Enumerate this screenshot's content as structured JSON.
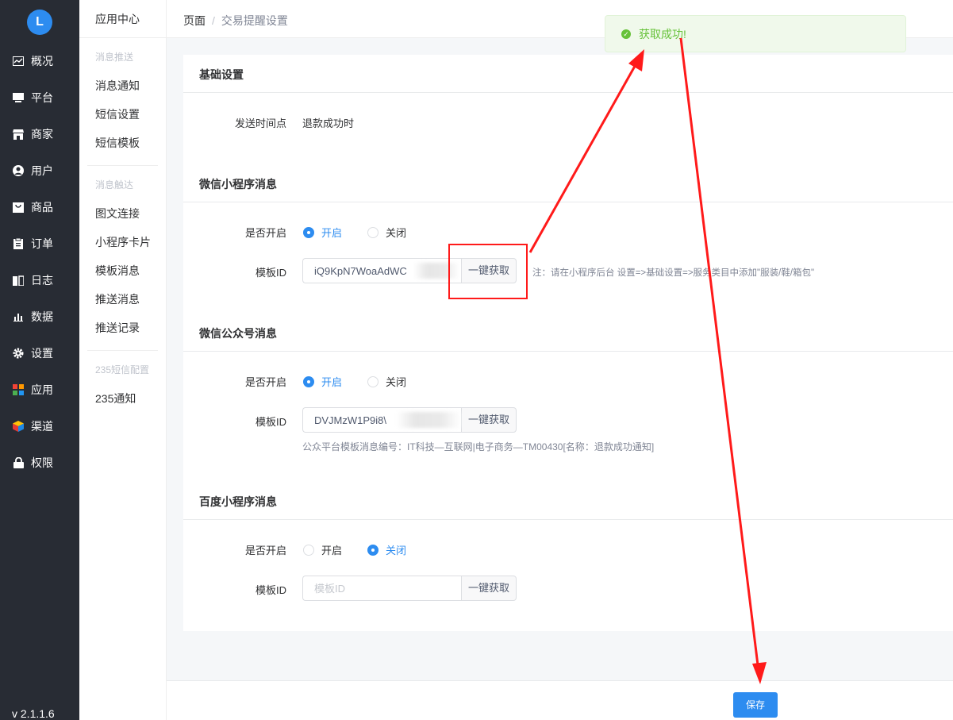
{
  "sidebar": {
    "logo_text": "L",
    "items": [
      {
        "label": "概况",
        "icon": "overview-icon"
      },
      {
        "label": "平台",
        "icon": "monitor-icon"
      },
      {
        "label": "商家",
        "icon": "store-icon"
      },
      {
        "label": "用户",
        "icon": "user-icon"
      },
      {
        "label": "商品",
        "icon": "goods-icon"
      },
      {
        "label": "订单",
        "icon": "order-icon"
      },
      {
        "label": "日志",
        "icon": "log-icon"
      },
      {
        "label": "数据",
        "icon": "chart-icon"
      },
      {
        "label": "设置",
        "icon": "gear-icon"
      },
      {
        "label": "应用",
        "icon": "apps-icon"
      },
      {
        "label": "渠道",
        "icon": "channel-icon"
      },
      {
        "label": "权限",
        "icon": "lock-icon"
      }
    ],
    "version": "v 2.1.1.6"
  },
  "submenu": {
    "title": "应用中心",
    "groups": [
      {
        "title": "消息推送",
        "items": [
          "消息通知",
          "短信设置",
          "短信模板"
        ]
      },
      {
        "title": "消息触达",
        "items": [
          "图文连接",
          "小程序卡片",
          "模板消息",
          "推送消息",
          "推送记录"
        ]
      },
      {
        "title": "235短信配置",
        "items": [
          "235通知"
        ]
      }
    ]
  },
  "breadcrumb": {
    "root": "页面",
    "sep": "/",
    "current": "交易提醒设置"
  },
  "basic": {
    "title": "基础设置",
    "send_time_label": "发送时间点",
    "send_time_value": "退款成功时"
  },
  "wechat_mini": {
    "title": "微信小程序消息",
    "enable_label": "是否开启",
    "on_label": "开启",
    "off_label": "关闭",
    "enabled": true,
    "template_label": "模板ID",
    "template_value": "iQ9KpN7WoaAdWC",
    "fetch_label": "一键获取",
    "note": "注：请在小程序后台 设置=>基础设置=>服务类目中添加\"服装/鞋/箱包\""
  },
  "wechat_official": {
    "title": "微信公众号消息",
    "enable_label": "是否开启",
    "on_label": "开启",
    "off_label": "关闭",
    "enabled": true,
    "template_label": "模板ID",
    "template_value": "DVJMzW1P9i8\\",
    "fetch_label": "一键获取",
    "note": "公众平台模板消息编号：IT科技—互联网|电子商务—TM00430[名称：退款成功通知]"
  },
  "baidu_mini": {
    "title": "百度小程序消息",
    "enable_label": "是否开启",
    "on_label": "开启",
    "off_label": "关闭",
    "enabled": false,
    "template_label": "模板ID",
    "template_placeholder": "模板ID",
    "fetch_label": "一键获取"
  },
  "footer": {
    "save_label": "保存"
  },
  "toast": {
    "text": "获取成功!",
    "icon": "check-circle-icon"
  },
  "colors": {
    "primary": "#2d8cf0",
    "sidebar": "#282c34",
    "success": "#67c23a",
    "annotation": "#ff1a1a"
  }
}
